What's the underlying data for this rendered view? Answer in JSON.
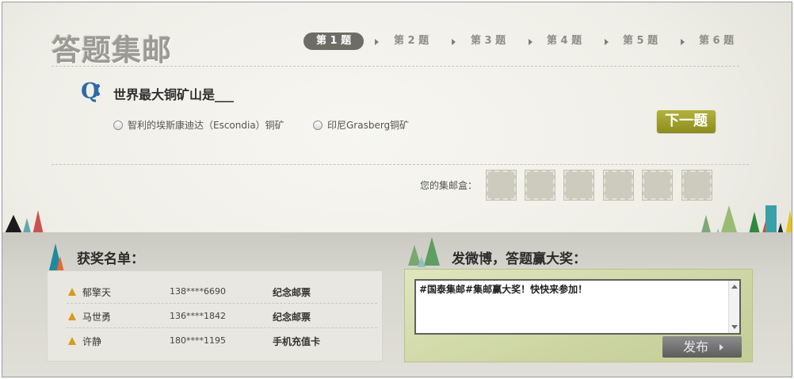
{
  "header": {
    "logo": "答题集邮",
    "steps": [
      "第 1 题",
      "第 2 题",
      "第 3 题",
      "第 4 题",
      "第 5 题",
      "第 6 题"
    ],
    "active_step": 0
  },
  "question": {
    "icon": "Q",
    "text": "世界最大铜矿山是___",
    "options": [
      "智利的埃斯康迪达（Escondia）铜矿",
      "印尼Grasberg铜矿"
    ],
    "next_label": "下一题"
  },
  "stamp_box": {
    "label": "您的集邮盒：",
    "slots": 6
  },
  "winners": {
    "title": "获奖名单：",
    "rows": [
      {
        "name": "郁擎天",
        "phone": "138****6690",
        "prize": "纪念邮票"
      },
      {
        "name": "马世勇",
        "phone": "136****1842",
        "prize": "纪念邮票"
      },
      {
        "name": "许静",
        "phone": "180****1195",
        "prize": "手机充值卡"
      }
    ]
  },
  "weibo": {
    "title": "发微博，答题赢大奖：",
    "text": "#国泰集邮#集邮赢大奖！快快来参加！",
    "publish_label": "发布"
  },
  "colors": {
    "accent_olive": "#9fa02e",
    "question_blue": "#2e6aa6",
    "active_step": "#6d6d66"
  }
}
